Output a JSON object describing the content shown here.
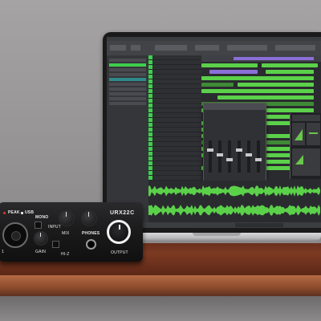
{
  "scene": {
    "description_colors": {
      "wall": "#959394",
      "table": "#7c3a22",
      "daw_green": "#5bd14a",
      "daw_purple": "#8a6fd8",
      "interface_body": "#1a1a1b"
    }
  },
  "interface": {
    "brand": "URX22C",
    "peak_label": "PEAK",
    "usb_label": "USB",
    "mono_label": "MONO",
    "input_label": "INPUT",
    "mix_label": "MIX",
    "phones_label": "PHONES",
    "output_label": "OUTPUT",
    "gain_label": "GAIN",
    "hiz_label": "HI-Z",
    "num_1": "1"
  },
  "daw": {
    "icons": [
      "meter-icon",
      "plugin-icon"
    ]
  }
}
